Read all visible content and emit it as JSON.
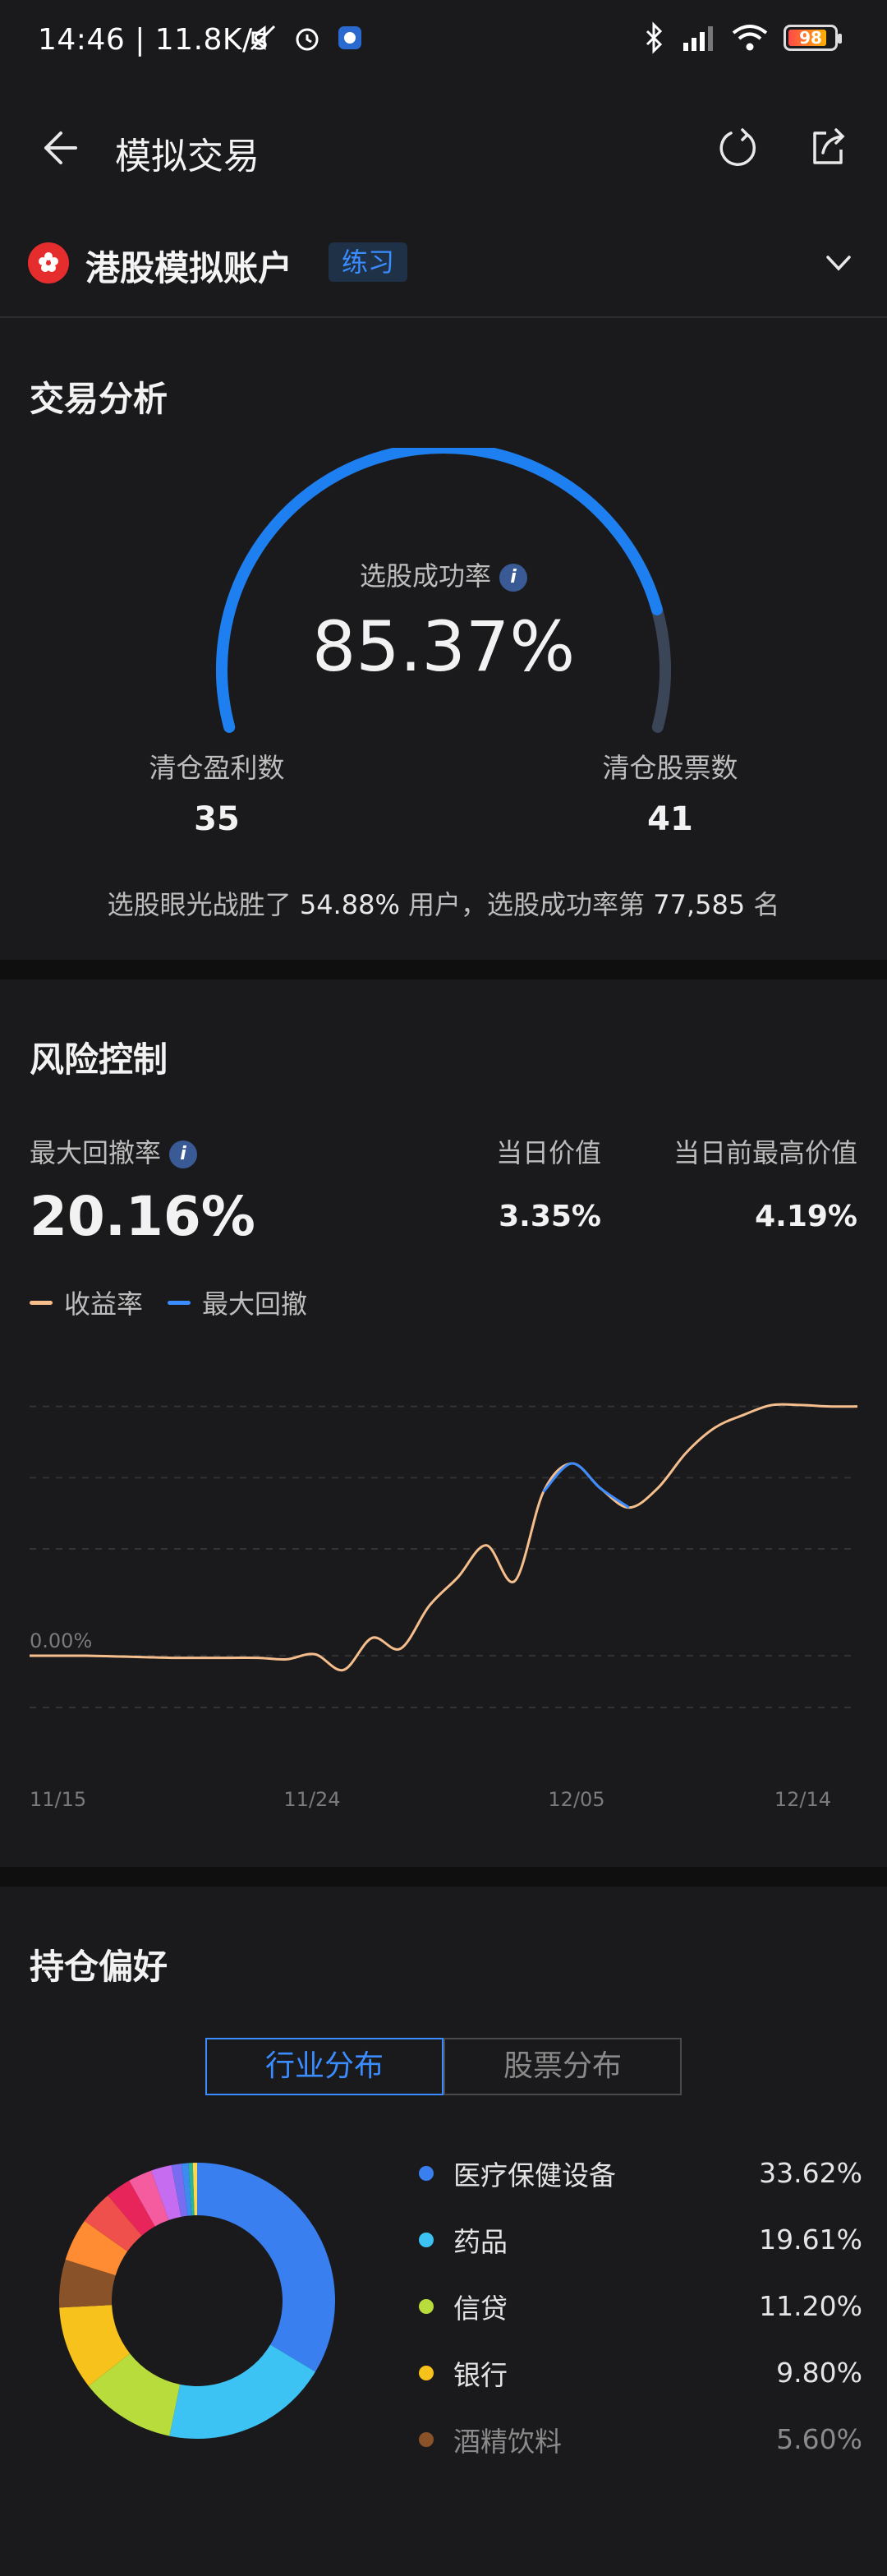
{
  "status_bar": {
    "time": "14:46 | 11.8K/s",
    "battery": "98"
  },
  "nav": {
    "title": "模拟交易"
  },
  "account": {
    "name": "港股模拟账户",
    "badge": "练习"
  },
  "analysis": {
    "title": "交易分析",
    "success_label": "选股成功率",
    "success_rate": "85.37%",
    "success_rate_value": 85.37,
    "profit_label": "清仓盈利数",
    "profit_count": "35",
    "cleared_label": "清仓股票数",
    "cleared_count": "41",
    "rank_prefix": "选股眼光战胜了",
    "rank_percent": "54.88%",
    "rank_middle": "用户，选股成功率第",
    "rank_number": "77,585",
    "rank_suffix": "名"
  },
  "risk": {
    "title": "风险控制",
    "drawdown_label": "最大回撤率",
    "drawdown_value": "20.16%",
    "today_label": "当日价值",
    "today_value": "3.35%",
    "high_label": "当日前最高价值",
    "high_value": "4.19%",
    "legend": [
      {
        "label": "收益率",
        "color": "#f5be8c"
      },
      {
        "label": "最大回撤",
        "color": "#3a8cff"
      }
    ]
  },
  "chart_data": {
    "type": "line",
    "x_ticks": [
      "11/15",
      "11/24",
      "12/05",
      "12/14"
    ],
    "y_ticks": [
      "0.00%"
    ],
    "grid": true,
    "series": [
      {
        "name": "收益率",
        "color": "#f5be8c",
        "values": [
          0,
          0,
          0,
          -0.01,
          -0.02,
          -0.03,
          -0.03,
          -0.03,
          -0.03,
          -0.05,
          0.02,
          -0.2,
          0.25,
          0.1,
          0.7,
          1.1,
          1.55,
          1.05,
          2.3,
          2.7,
          2.35,
          2.08,
          2.35,
          2.85,
          3.2,
          3.38,
          3.52,
          3.52,
          3.5,
          3.5
        ]
      },
      {
        "name": "最大回撤",
        "color": "#3a8cff",
        "start_index": 18,
        "values": [
          2.3,
          2.7,
          2.35,
          2.08
        ]
      }
    ]
  },
  "holdings": {
    "title": "持仓偏好",
    "tabs": [
      "行业分布",
      "股票分布"
    ],
    "active_tab": 0,
    "items": [
      {
        "name": "医疗保健设备",
        "pct": "33.62%",
        "value": 33.62,
        "color": "#3a7ff0"
      },
      {
        "name": "药品",
        "pct": "19.61%",
        "value": 19.61,
        "color": "#3cc3f4"
      },
      {
        "name": "信贷",
        "pct": "11.20%",
        "value": 11.2,
        "color": "#b8dc3c"
      },
      {
        "name": "银行",
        "pct": "9.80%",
        "value": 9.8,
        "color": "#f7c21c"
      },
      {
        "name": "酒精饮料",
        "pct": "5.60%",
        "value": 5.6,
        "color": "#8a5228"
      }
    ],
    "other_slices": [
      {
        "value": 5.0,
        "color": "#ff8c32"
      },
      {
        "value": 4.0,
        "color": "#f0504b"
      },
      {
        "value": 3.0,
        "color": "#e8255a"
      },
      {
        "value": 2.8,
        "color": "#f55ca0"
      },
      {
        "value": 2.4,
        "color": "#c56cf0"
      },
      {
        "value": 1.2,
        "color": "#7a6cf0"
      },
      {
        "value": 0.8,
        "color": "#3c8cf0"
      },
      {
        "value": 0.5,
        "color": "#28b49a"
      },
      {
        "value": 0.5,
        "color": "#ffd84a"
      }
    ]
  }
}
